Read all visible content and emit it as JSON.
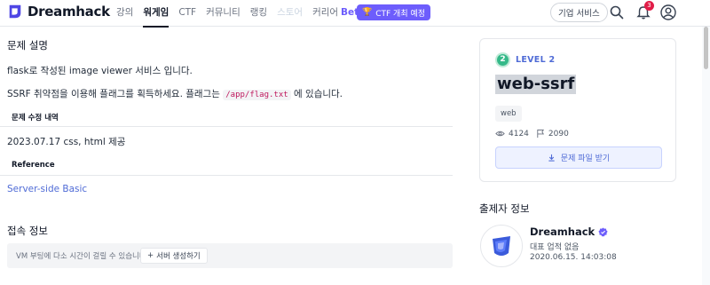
{
  "nav": {
    "brand": "Dreamhack",
    "links": [
      "강의",
      "워게임",
      "CTF",
      "커뮤니티",
      "랭킹",
      "스토어",
      "커리어"
    ],
    "beta": "Beta",
    "ctf_button": "CTF 개최 예정",
    "biz_button": "기업 서비스",
    "notification_count": "3",
    "accent": "#6d5dfc"
  },
  "problem": {
    "heading": "문제 설명",
    "line1": "flask로 작성된 image viewer 서비스 입니다.",
    "line2_pre": "SSRF 취약점을 이용해 플래그를 획득하세요. 플래그는",
    "flag_path": "/app/flag.txt",
    "line2_post": "에 있습니다.",
    "revision_heading": "문제 수정 내역",
    "revision": "2023.07.17 css, html 제공",
    "reference_heading": "Reference",
    "reference_link": "Server-side Basic"
  },
  "connection": {
    "heading": "접속 정보",
    "notice": "VM 부팅에 다소 시간이 걸릴 수 있습니다.",
    "button": "서버 생성하기"
  },
  "card": {
    "level_num": "2",
    "level_label": "LEVEL 2",
    "title": "web-ssrf",
    "tag": "web",
    "views": "4124",
    "solves": "2090",
    "download": "문제 파일 받기"
  },
  "author": {
    "heading": "출제자 정보",
    "name": "Dreamhack",
    "subtitle": "대표 업적 없음",
    "date": "2020.06.15. 14:03:08"
  }
}
